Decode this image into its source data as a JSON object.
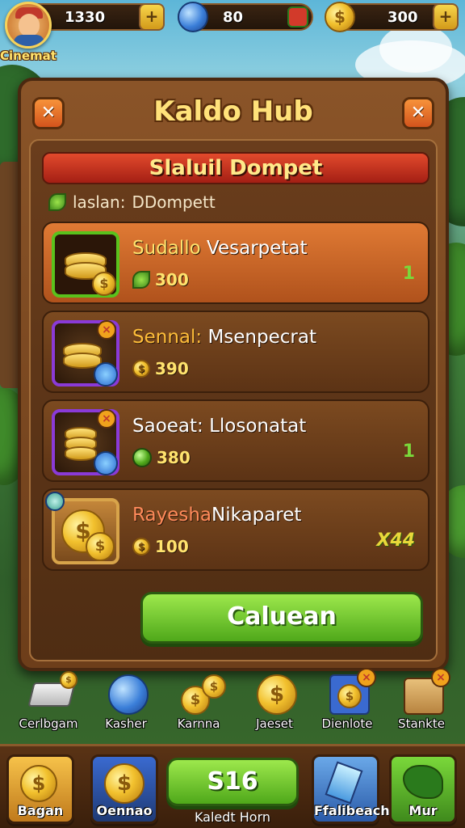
{
  "player": {
    "name": "Cinemat"
  },
  "currencies": [
    {
      "icon": "coin-icon",
      "value": "1330",
      "add": "+"
    },
    {
      "icon": "gem-icon",
      "value": "80"
    },
    {
      "icon": "gold-coin-icon",
      "value": "300",
      "add": "+"
    }
  ],
  "panel": {
    "title": "Kaldo Hub",
    "close_left": "✕",
    "close_right": "✕",
    "ribbon": "Slaluil Dompet",
    "subtitle_prefix": "laslan:",
    "subtitle": "DDompett",
    "rows": [
      {
        "title_hl": "Sudallo",
        "title": "Vesarpetat",
        "price": "300",
        "right": "1"
      },
      {
        "title_hl": "Sennal:",
        "title": "Msenpecrat",
        "price": "390",
        "right": ""
      },
      {
        "title_hl": "",
        "title": "Saoeat: Llosonatat",
        "price": "380",
        "right": "1"
      },
      {
        "title_hl": "Rayesha",
        "title": "Nikaparet",
        "price": "100",
        "right": "X44"
      }
    ],
    "cta": "Caluean"
  },
  "shop_items": [
    {
      "label": "Cerlbgam",
      "icon": "cash-stack-icon"
    },
    {
      "label": "Kasher",
      "icon": "blue-gem-icon"
    },
    {
      "label": "Karnna",
      "icon": "coins-icon"
    },
    {
      "label": "Jaeset",
      "icon": "gold-coin-icon"
    },
    {
      "label": "Dienlote",
      "icon": "coin-bag-icon"
    },
    {
      "label": "Stankte",
      "icon": "gift-box-icon"
    }
  ],
  "bottom_nav": {
    "left1": "Bagan",
    "left2": "Oennao",
    "center_value": "S16",
    "center_label": "Kaledt Horn",
    "right1": "Ffalibeach",
    "right2": "Mur"
  }
}
